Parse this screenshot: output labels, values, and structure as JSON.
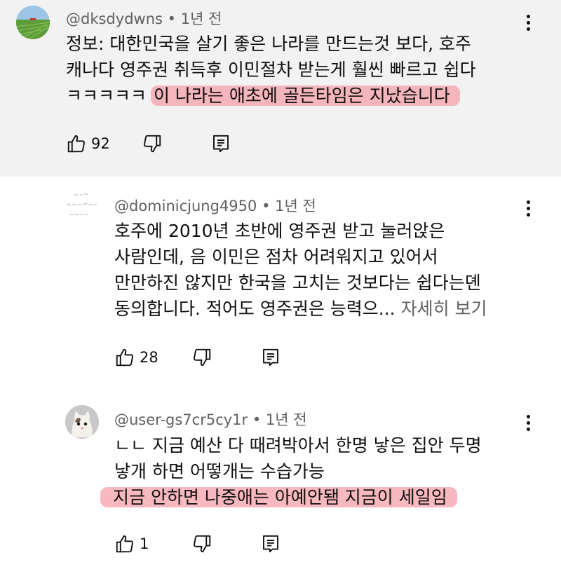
{
  "comments": [
    {
      "handle": "@dksdydwns",
      "time": "• 1년 전",
      "lines": [
        {
          "plain": "정보: 대한민국을 살기 좋은 나라를 만드는것 보다, 호주",
          "hl": ""
        },
        {
          "plain": "캐나다 영주권 취득후 이민절차 받는게 훨씬 빠르고 쉽다",
          "hl": ""
        },
        {
          "plain": "ㅋㅋㅋㅋㅋ",
          "hl": "이 나라는 애초에 골든타임은 지났습니다"
        }
      ],
      "likes": "92",
      "highlight_color": "#f6a0aa",
      "background": "#f2f2f2"
    },
    {
      "handle": "@dominicjung4950",
      "time": "• 1년 전",
      "lines": [
        {
          "plain": "호주에 2010년 초반에 영주권 받고 눌러앉은",
          "hl": ""
        },
        {
          "plain": "사람인데, 음 이민은 점차 어려워지고 있어서",
          "hl": ""
        },
        {
          "plain": "만만하진 않지만 한국을 고치는 것보다는 쉽다는뎬",
          "hl": ""
        },
        {
          "plain": "동의합니다.  적어도 영주권은 능력으...",
          "hl": ""
        }
      ],
      "read_more": "자세히 보기",
      "likes": "28"
    },
    {
      "handle": "@user-gs7cr5cy1r",
      "time": "• 1년 전",
      "lines": [
        {
          "plain": "ㄴㄴ 지금 예산 다 때려박아서 한명 낳은 집안 두명",
          "hl": ""
        },
        {
          "plain": "낳개 하면 어떻개는 수습가능",
          "hl": ""
        },
        {
          "plain": "",
          "hl": "지금 안하면 나중애는 아예안됌 지금이 세일임"
        }
      ],
      "likes": "1"
    }
  ],
  "icons": {
    "like": "thumbs-up-icon",
    "dislike": "thumbs-down-icon",
    "reply": "reply-comment-icon",
    "menu": "more-vertical-icon"
  }
}
